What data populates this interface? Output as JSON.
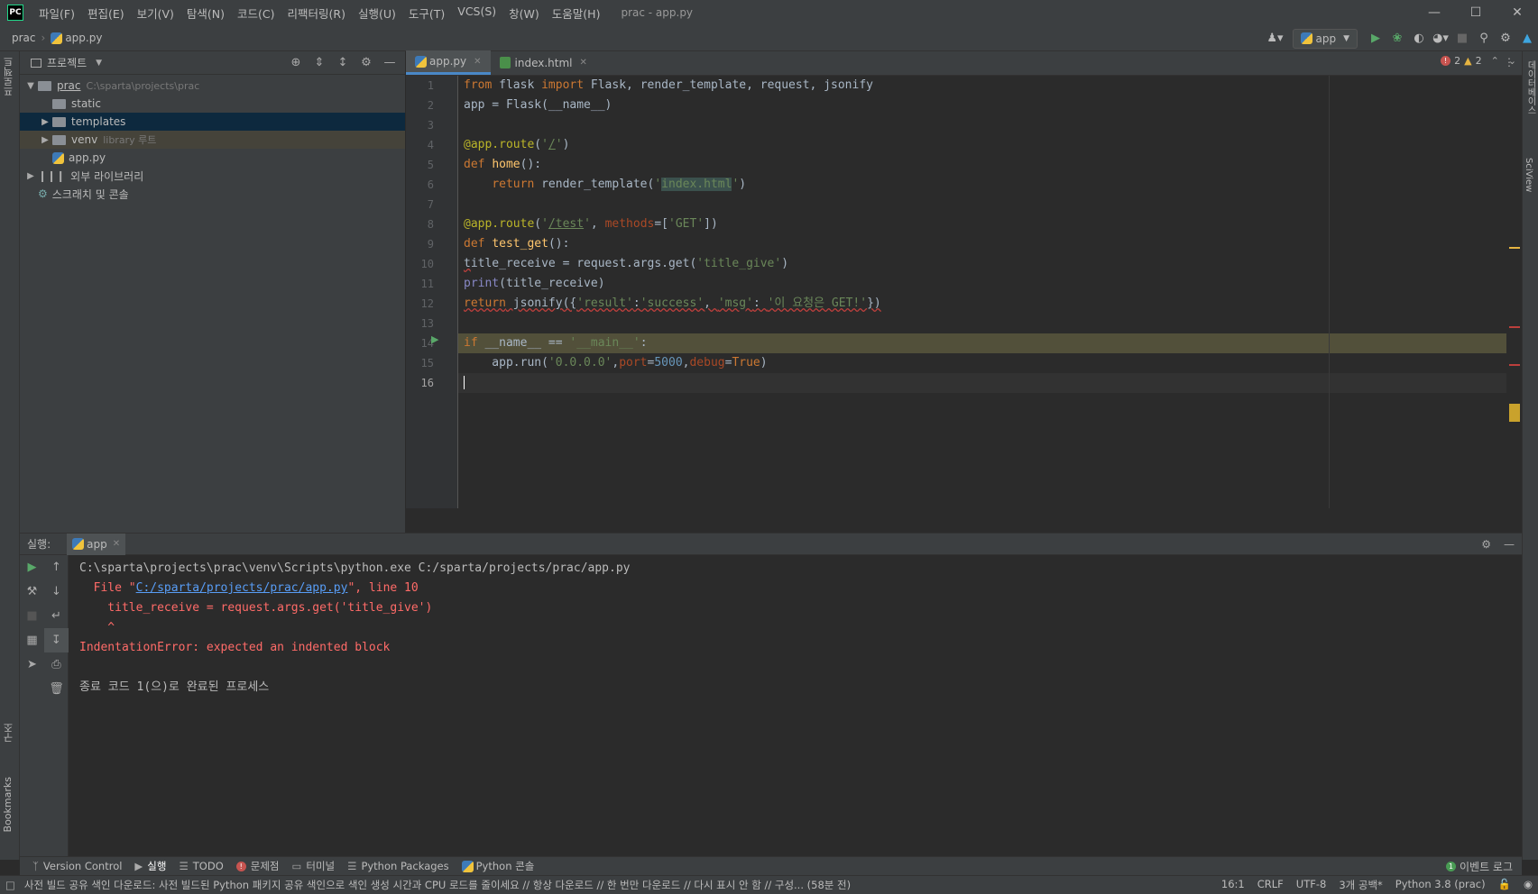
{
  "titlebar": {
    "menu": [
      "파일(F)",
      "편집(E)",
      "보기(V)",
      "탐색(N)",
      "코드(C)",
      "리팩터링(R)",
      "실행(U)",
      "도구(T)",
      "VCS(S)",
      "창(W)",
      "도움말(H)"
    ],
    "window_title": "prac - app.py"
  },
  "navbar": {
    "project": "prac",
    "file": "app.py",
    "run_config": "app"
  },
  "left_strip": {
    "project_tab": "프로젝트",
    "structure_tab": "구조",
    "bookmarks_tab": "Bookmarks"
  },
  "right_strip": {
    "database_tab": "데이터베이스",
    "sciview_tab": "SciView"
  },
  "project_panel": {
    "title": "프로젝트",
    "root_name": "prac",
    "root_path": "C:\\sparta\\projects\\prac",
    "static": "static",
    "templates": "templates",
    "venv": "venv",
    "venv_note": "library 루트",
    "app_file": "app.py",
    "external_libs": "외부 라이브러리",
    "scratches": "스크래치 및 콘솔"
  },
  "editor": {
    "tabs": [
      "app.py",
      "index.html"
    ],
    "errors": "2",
    "warnings": "2",
    "line_numbers": [
      "1",
      "2",
      "3",
      "4",
      "5",
      "6",
      "7",
      "8",
      "9",
      "10",
      "11",
      "12",
      "13",
      "14",
      "15",
      "16"
    ]
  },
  "run_panel": {
    "label": "실행:",
    "tab": "app",
    "console": {
      "l1": "C:\\sparta\\projects\\prac\\venv\\Scripts\\python.exe C:/sparta/projects/prac/app.py",
      "l2_pre": "  File \"",
      "l2_link": "C:/sparta/projects/prac/app.py",
      "l2_post": "\", line 10",
      "l3": "    title_receive = request.args.get('title_give')",
      "l4": "    ^",
      "l5": "IndentationError: expected an indented block",
      "l7": "종료 코드 1(으)로 완료된 프로세스"
    }
  },
  "tool_windows": {
    "version_control": "Version Control",
    "run": "실행",
    "todo": "TODO",
    "problems": "문제점",
    "terminal": "터미널",
    "python_packages": "Python Packages",
    "python_console": "Python 콘솔",
    "event_log": "이벤트 로그"
  },
  "statusbar": {
    "message": "사전 빌드 공유 색인 다운로드: 사전 빌드된 Python 패키지 공유 색인으로 색인 생성 시간과 CPU 로드를 줄이세요 // 항상 다운로드 // 한 번만 다운로드 // 다시 표시 안 함 // 구성... (58분 전)",
    "position": "16:1",
    "line_sep": "CRLF",
    "encoding": "UTF-8",
    "indent": "3개 공백*",
    "interpreter": "Python 3.8 (prac)"
  },
  "colors": {
    "accent": "#4a88c7",
    "error": "#ff6b68",
    "link": "#589df6"
  }
}
